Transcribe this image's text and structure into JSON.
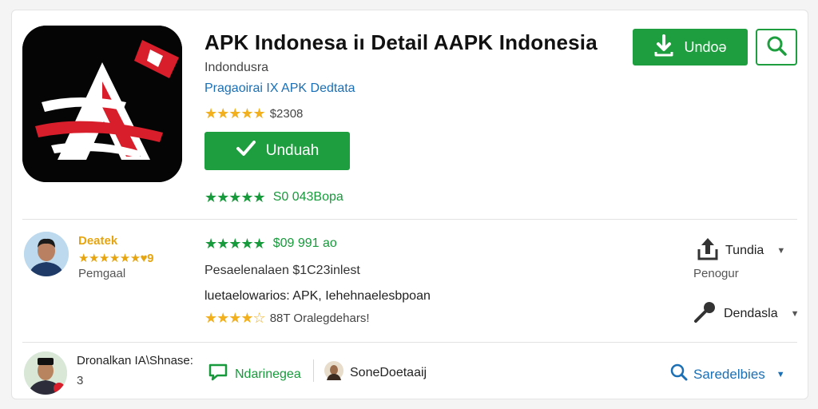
{
  "app": {
    "title": "APK Indonesa iı Detail AAPK Indonesia",
    "developer": "Indondusra",
    "category": "Pragaoirai IX APK Dedtata",
    "rating_stars": "★★★★★",
    "rating_text": "$2308",
    "download_label": "Unduah",
    "downloads_stars": "★★★★★",
    "downloads_text": "S0 043Bopa",
    "icon_name": "apk-logo-icon"
  },
  "header": {
    "download_label": "Undoə",
    "download_icon": "download-arrow-icon",
    "search_icon": "search-icon"
  },
  "review": {
    "user_name": "Deatek",
    "user_stars": "★★★★★★♥9",
    "user_role": "Pemgaal",
    "rating_stars": "★★★★★",
    "rating_text": "$09 991 ao",
    "line1": "Pesaelenalaen $1C23inlest",
    "line2": "luetaelowarios: APK, Iehehnaelesbpoan",
    "rating2_stars": "★★★★☆",
    "rating2_text": "88T Oralegdehars!",
    "action1_label": "Tundia",
    "action1_sub": "Penogur",
    "action2_label": "Dendasla"
  },
  "bottom": {
    "user_name": "Dronalkan IA\\Shnase:",
    "user_count": "3",
    "chip1_label": "Ndarinegea",
    "chip2_label": "SoneDoetaaij",
    "filter_label": "Saredelbies"
  },
  "colors": {
    "brand_green": "#1e9e3e",
    "star_gold": "#f2b01e",
    "star_green": "#179a3b",
    "link_blue": "#1a6fb5",
    "logo_red": "#d81e2a"
  }
}
